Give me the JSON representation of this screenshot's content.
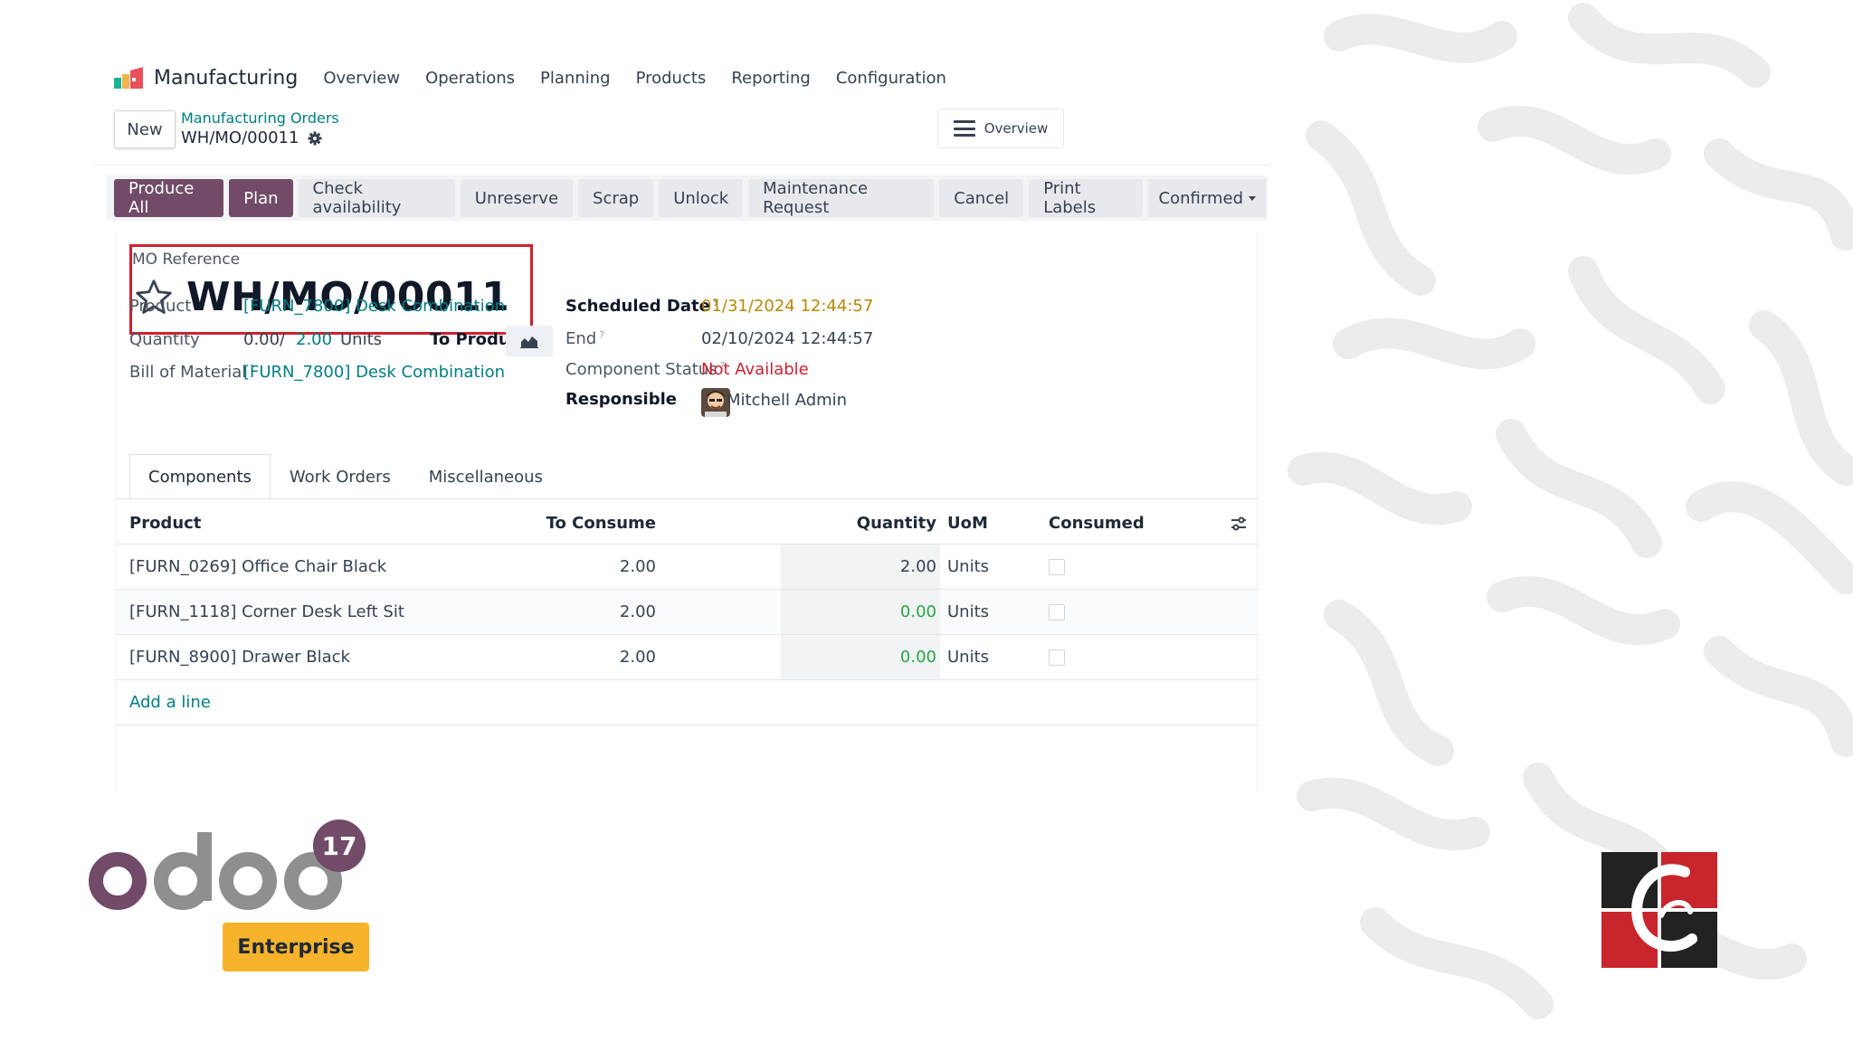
{
  "nav": {
    "app_name": "Manufacturing",
    "items": [
      "Overview",
      "Operations",
      "Planning",
      "Products",
      "Reporting",
      "Configuration"
    ]
  },
  "control_panel": {
    "new_label": "New",
    "breadcrumb_parent": "Manufacturing Orders",
    "breadcrumb_current": "WH/MO/00011",
    "overview_label": "Overview"
  },
  "actions": {
    "primary": [
      "Produce All",
      "Plan"
    ],
    "secondary": [
      "Check availability",
      "Unreserve",
      "Scrap",
      "Unlock",
      "Maintenance Request",
      "Cancel",
      "Print Labels"
    ],
    "status": "Confirmed"
  },
  "form": {
    "ref_label": "MO Reference",
    "ref_value": "WH/MO/00011",
    "product_label": "Product",
    "product_value": "[FURN_7800] Desk Combination",
    "quantity_label": "Quantity",
    "quantity_produced": "0.00",
    "quantity_sep": "/",
    "quantity_total": "2.00",
    "quantity_uom": "Units",
    "to_produce_label": "To Produce",
    "bom_label": "Bill of Material",
    "bom_value": "[FURN_7800] Desk Combination",
    "scheduled_label": "Scheduled Date",
    "scheduled_value": "01/31/2024 12:44:57",
    "end_label": "End",
    "end_value": "02/10/2024 12:44:57",
    "component_status_label": "Component Status",
    "component_status_value": "Not Available",
    "responsible_label": "Responsible",
    "responsible_value": "Mitchell Admin",
    "help_mark": "?"
  },
  "tabs": [
    "Components",
    "Work Orders",
    "Miscellaneous"
  ],
  "table": {
    "headers": {
      "product": "Product",
      "to_consume": "To Consume",
      "quantity": "Quantity",
      "uom": "UoM",
      "consumed": "Consumed"
    },
    "rows": [
      {
        "product": "[FURN_0269] Office Chair Black",
        "to_consume": "2.00",
        "quantity": "2.00",
        "uom": "Units"
      },
      {
        "product": "[FURN_1118] Corner Desk Left Sit",
        "to_consume": "2.00",
        "quantity": "0.00",
        "uom": "Units"
      },
      {
        "product": "[FURN_8900] Drawer Black",
        "to_consume": "2.00",
        "quantity": "0.00",
        "uom": "Units"
      }
    ],
    "add_line": "Add a line"
  },
  "branding": {
    "odoo_version": "17",
    "edition": "Enterprise",
    "odoo_wordmark": "odoo"
  },
  "colors": {
    "primary": "#714b67",
    "link": "#017e84",
    "highlight_box": "#d0212f",
    "warning": "#b88708",
    "danger": "#d0212f",
    "success": "#28a745",
    "enterprise_badge": "#f7b32b"
  }
}
